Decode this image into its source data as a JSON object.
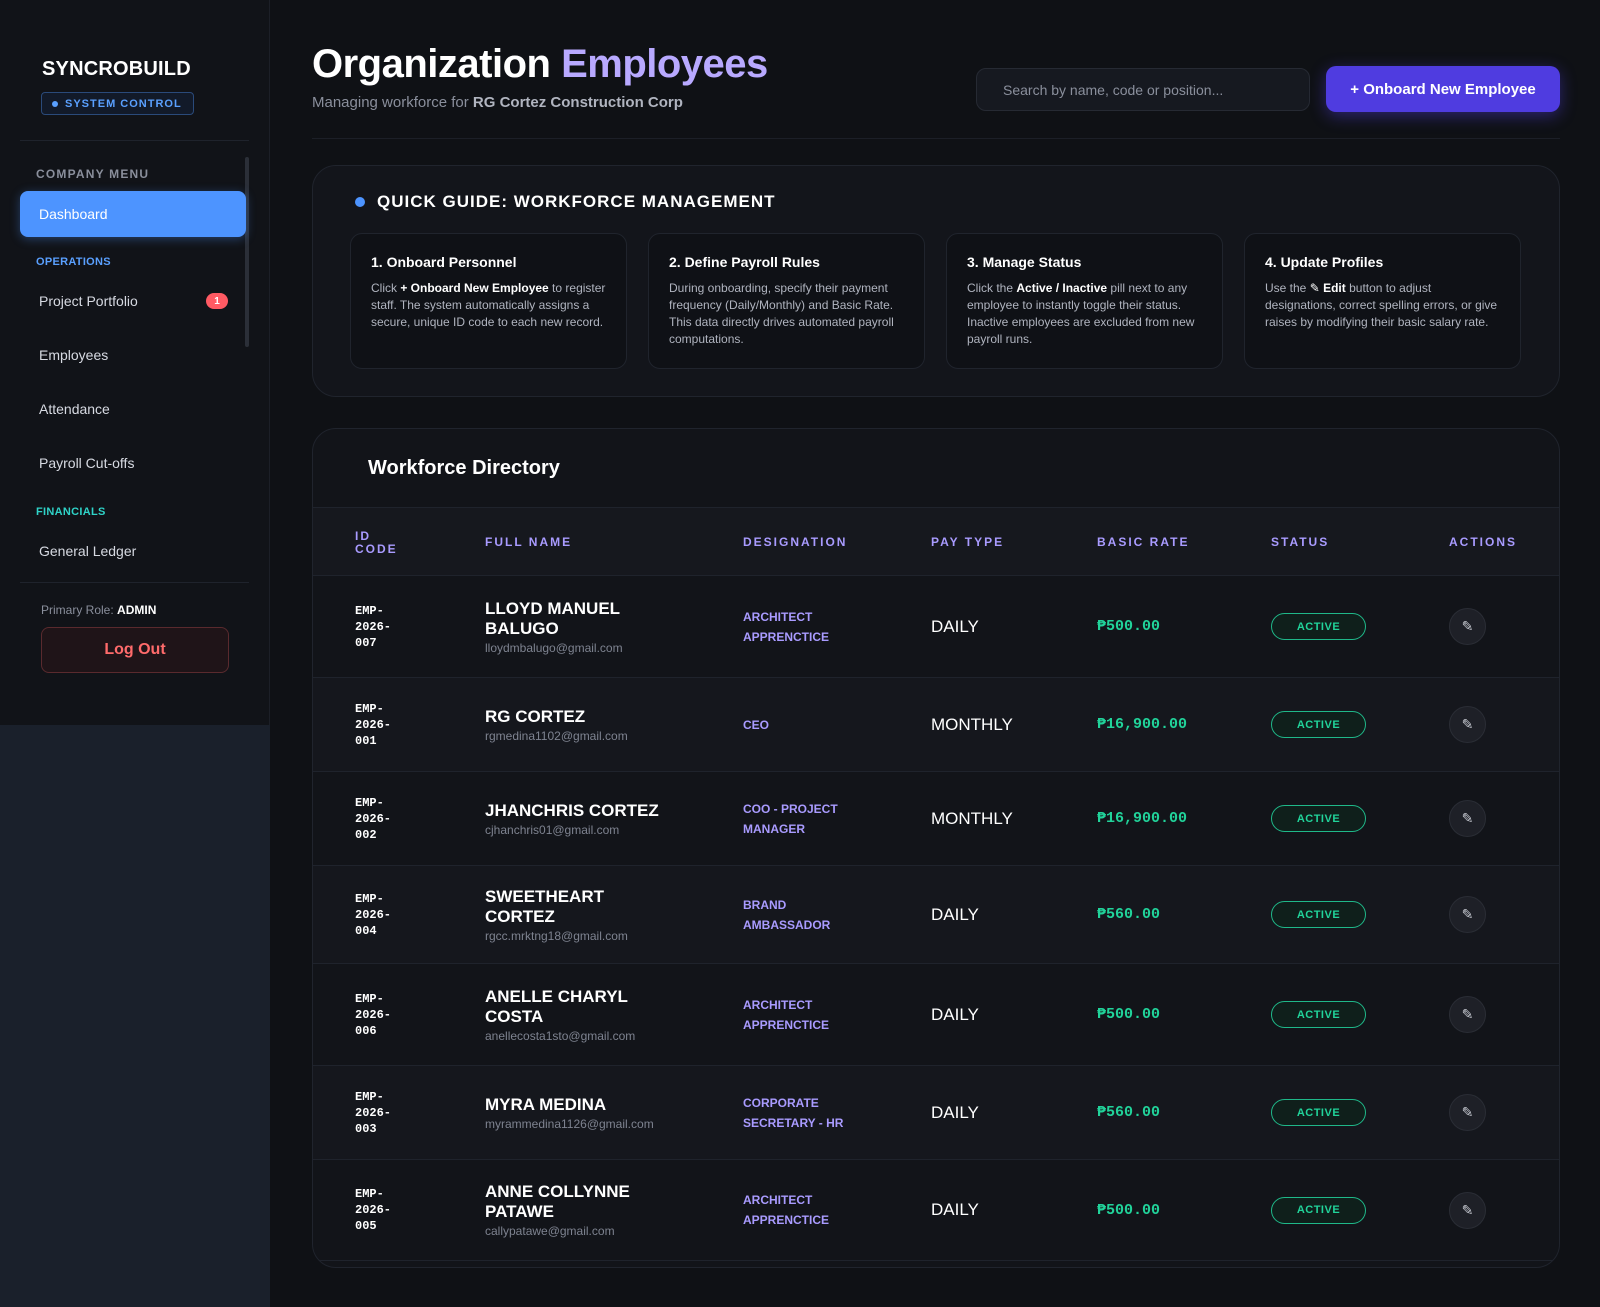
{
  "sidebar": {
    "brand": "SYNCROBUILD",
    "system_badge": "SYSTEM CONTROL",
    "menu_title": "COMPANY MENU",
    "dashboard": "Dashboard",
    "operations_label": "OPERATIONS",
    "operations": [
      {
        "label": "Project Portfolio",
        "badge": "1"
      },
      {
        "label": "Employees"
      },
      {
        "label": "Attendance"
      },
      {
        "label": "Payroll Cut-offs"
      }
    ],
    "financials_label": "FINANCIALS",
    "financials": [
      {
        "label": "General Ledger"
      }
    ],
    "role_label": "Primary Role:",
    "role_value": "ADMIN",
    "logout": "Log Out"
  },
  "header": {
    "title_main": "Organization",
    "title_accent": "Employees",
    "subtitle_prefix": "Managing workforce for",
    "company": "RG Cortez Construction Corp",
    "search_placeholder": "Search by name, code or position...",
    "onboard_button": "+ Onboard New Employee"
  },
  "guide": {
    "title": "QUICK GUIDE: WORKFORCE MANAGEMENT",
    "cards": [
      {
        "title": "1. Onboard Personnel",
        "pre": "Click ",
        "bold": "+ Onboard New Employee",
        "post": " to register staff. The system automatically assigns a secure, unique ID code to each new record."
      },
      {
        "title": "2. Define Payroll Rules",
        "pre": "During onboarding, specify their payment frequency (Daily/Monthly) and Basic Rate. This data directly drives automated payroll computations.",
        "bold": "",
        "post": ""
      },
      {
        "title": "3. Manage Status",
        "pre": "Click the ",
        "bold": "Active / Inactive",
        "post": " pill next to any employee to instantly toggle their status. Inactive employees are excluded from new payroll runs."
      },
      {
        "title": "4. Update Profiles",
        "pre": "Use the ",
        "bold": "✎ Edit",
        "post": " button to adjust designations, correct spelling errors, or give raises by modifying their basic salary rate."
      }
    ]
  },
  "directory": {
    "title": "Workforce Directory",
    "columns": [
      "ID CODE",
      "FULL NAME",
      "DESIGNATION",
      "PAY TYPE",
      "BASIC RATE",
      "STATUS",
      "ACTIONS"
    ],
    "rows": [
      {
        "id_lines": [
          "EMP-",
          "2026-",
          "007"
        ],
        "name_lines": [
          "LLOYD MANUEL",
          "BALUGO"
        ],
        "email": "lloydmbalugo@gmail.com",
        "designation_lines": [
          "ARCHITECT",
          "APPRENCTICE"
        ],
        "pay_type": "DAILY",
        "rate": "₱500.00",
        "status": "ACTIVE"
      },
      {
        "id_lines": [
          "EMP-",
          "2026-",
          "001"
        ],
        "name_lines": [
          "RG CORTEZ"
        ],
        "email": "rgmedina1102@gmail.com",
        "designation_lines": [
          "CEO"
        ],
        "pay_type": "MONTHLY",
        "rate": "₱16,900.00",
        "status": "ACTIVE"
      },
      {
        "id_lines": [
          "EMP-",
          "2026-",
          "002"
        ],
        "name_lines": [
          "JHANCHRIS CORTEZ"
        ],
        "email": "cjhanchris01@gmail.com",
        "designation_lines": [
          "COO - PROJECT",
          "MANAGER"
        ],
        "pay_type": "MONTHLY",
        "rate": "₱16,900.00",
        "status": "ACTIVE"
      },
      {
        "id_lines": [
          "EMP-",
          "2026-",
          "004"
        ],
        "name_lines": [
          "SWEETHEART",
          "CORTEZ"
        ],
        "email": "rgcc.mrktng18@gmail.com",
        "designation_lines": [
          "BRAND",
          "AMBASSADOR"
        ],
        "pay_type": "DAILY",
        "rate": "₱560.00",
        "status": "ACTIVE"
      },
      {
        "id_lines": [
          "EMP-",
          "2026-",
          "006"
        ],
        "name_lines": [
          "ANELLE CHARYL",
          "COSTA"
        ],
        "email": "anellecosta1sto@gmail.com",
        "designation_lines": [
          "ARCHITECT",
          "APPRENCTICE"
        ],
        "pay_type": "DAILY",
        "rate": "₱500.00",
        "status": "ACTIVE"
      },
      {
        "id_lines": [
          "EMP-",
          "2026-",
          "003"
        ],
        "name_lines": [
          "MYRA MEDINA"
        ],
        "email": "myrammedina1126@gmail.com",
        "designation_lines": [
          "CORPORATE",
          "SECRETARY - HR"
        ],
        "pay_type": "DAILY",
        "rate": "₱560.00",
        "status": "ACTIVE"
      },
      {
        "id_lines": [
          "EMP-",
          "2026-",
          "005"
        ],
        "name_lines": [
          "ANNE COLLYNNE",
          "PATAWE"
        ],
        "email": "callypatawe@gmail.com",
        "designation_lines": [
          "ARCHITECT",
          "APPRENCTICE"
        ],
        "pay_type": "DAILY",
        "rate": "₱500.00",
        "status": "ACTIVE"
      }
    ]
  },
  "icons": {
    "status_dot": "dot-icon",
    "edit": "pencil-icon"
  },
  "colors": {
    "accent_blue": "#4d94ff",
    "accent_purple": "#4f3ce0",
    "designation": "#a99bff",
    "money_green": "#21d39a",
    "danger": "#ff6b6b"
  }
}
